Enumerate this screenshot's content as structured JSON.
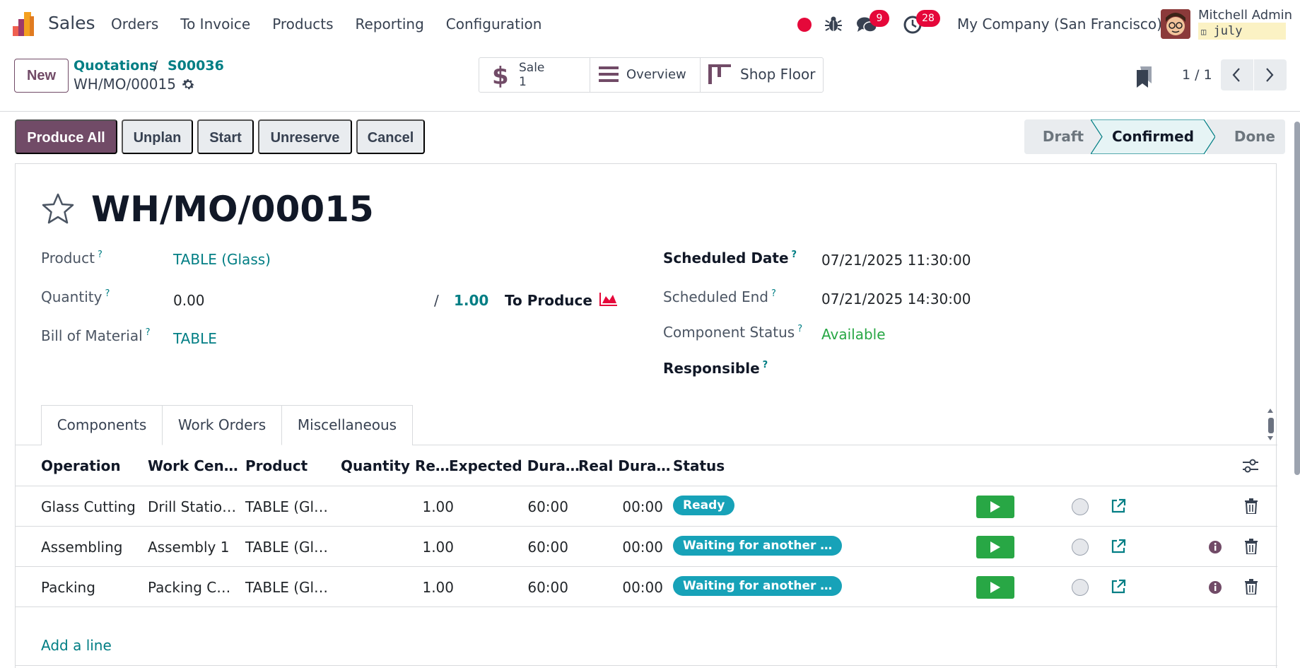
{
  "navbar": {
    "app_name": "Sales",
    "menu": [
      "Orders",
      "To Invoice",
      "Products",
      "Reporting",
      "Configuration"
    ],
    "chat_count": "9",
    "activity_count": "28",
    "company": "My Company (San Francisco)",
    "user_name": "Mitchell Admin",
    "db_name": "july"
  },
  "control": {
    "new_label": "New",
    "breadcrumb": [
      "Quotations",
      "S00036"
    ],
    "breadcrumb_sep": "/",
    "record_name": "WH/MO/00015",
    "smart_buttons": {
      "sale_label": "Sale",
      "sale_value": "1",
      "overview_label": "Overview",
      "shop_floor_label": "Shop Floor"
    },
    "pager": "1 / 1"
  },
  "actions": {
    "produce_all": "Produce All",
    "unplan": "Unplan",
    "start": "Start",
    "unreserve": "Unreserve",
    "cancel": "Cancel"
  },
  "stages": {
    "draft": "Draft",
    "confirmed": "Confirmed",
    "done": "Done",
    "current": "Confirmed"
  },
  "form": {
    "title": "WH/MO/00015",
    "product_label": "Product",
    "product_value": "TABLE (Glass)",
    "quantity_label": "Quantity",
    "quantity_value": "0.00",
    "quantity_sep": "/",
    "quantity_target": "1.00",
    "to_produce_label": "To Produce",
    "bom_label": "Bill of Material",
    "bom_value": "TABLE",
    "scheduled_date_label": "Scheduled Date",
    "scheduled_date_value": "07/21/2025 11:30:00",
    "scheduled_end_label": "Scheduled End",
    "scheduled_end_value": "07/21/2025 14:30:00",
    "component_status_label": "Component Status",
    "component_status_value": "Available",
    "responsible_label": "Responsible",
    "help_mark": "?"
  },
  "tabs": [
    "Components",
    "Work Orders",
    "Miscellaneous"
  ],
  "work_orders": {
    "columns": [
      "Operation",
      "Work Cen…",
      "Product",
      "Quantity Re…",
      "Expected Dura…",
      "Real Dura…",
      "Status"
    ],
    "rows": [
      {
        "operation": "Glass Cutting",
        "work_center": "Drill Statio…",
        "product": "TABLE (Gl…",
        "quantity": "1.00",
        "expected": "60:00",
        "real": "00:00",
        "status": "Ready"
      },
      {
        "operation": "Assembling",
        "work_center": "Assembly 1",
        "product": "TABLE (Gl…",
        "quantity": "1.00",
        "expected": "60:00",
        "real": "00:00",
        "status": "Waiting for another …"
      },
      {
        "operation": "Packing",
        "work_center": "Packing C…",
        "product": "TABLE (Gl…",
        "quantity": "1.00",
        "expected": "60:00",
        "real": "00:00",
        "status": "Waiting for another …"
      }
    ],
    "add_line": "Add a line"
  },
  "colors": {
    "brand": "#714b67",
    "link": "#017e84",
    "badge": "#17a2b8",
    "play": "#28a745",
    "alert": "#e5083a"
  }
}
